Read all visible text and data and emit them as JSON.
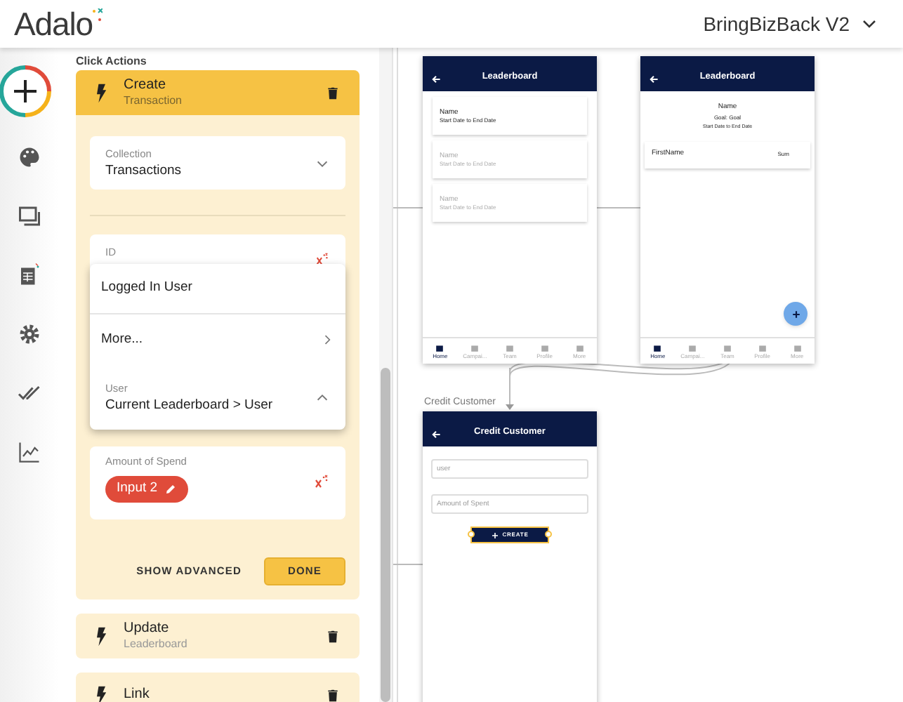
{
  "header": {
    "logo": "Adalo",
    "project_title": "BringBizBack V2"
  },
  "panel": {
    "heading": "Click Actions",
    "actions": [
      {
        "title": "Create",
        "subtitle": "Transaction",
        "expanded": true,
        "form": {
          "collection": {
            "label": "Collection",
            "value": "Transactions"
          },
          "id_field": {
            "label": "ID"
          },
          "menu": [
            {
              "kind": "option",
              "label": "Logged In User"
            },
            {
              "kind": "submenu",
              "label": "More..."
            },
            {
              "kind": "current",
              "label": "User",
              "value": "Current Leaderboard > User"
            }
          ],
          "amount": {
            "label": "Amount of Spend",
            "chip": "Input 2"
          },
          "advanced_button": "SHOW ADVANCED",
          "done_button": "DONE"
        }
      },
      {
        "title": "Update",
        "subtitle": "Leaderboard",
        "expanded": false
      },
      {
        "title": "Link",
        "expanded": false
      }
    ]
  },
  "canvas": {
    "screens": [
      {
        "kind": "list",
        "title": "Leaderboard",
        "items": [
          {
            "name": "Name",
            "dates": "Start Date to End Date",
            "faded": false
          },
          {
            "name": "Name",
            "dates": "Start Date to End Date",
            "faded": true
          },
          {
            "name": "Name",
            "dates": "Start Date to End Date",
            "faded": true
          }
        ],
        "tabs": [
          {
            "label": "Home",
            "selected": true
          },
          {
            "label": "Campai...",
            "selected": false
          },
          {
            "label": "Team",
            "selected": false
          },
          {
            "label": "Profile",
            "selected": false
          },
          {
            "label": "More",
            "selected": false
          }
        ]
      },
      {
        "kind": "detail",
        "title": "Leaderboard",
        "name": "Name",
        "goal": "Goal: Goal",
        "dates": "Start Date to End Date",
        "row": {
          "label": "FirstName",
          "value": "Sum"
        },
        "tabs": [
          {
            "label": "Home",
            "selected": true
          },
          {
            "label": "Campai...",
            "selected": false
          },
          {
            "label": "Team",
            "selected": false
          },
          {
            "label": "Profile",
            "selected": false
          },
          {
            "label": "More",
            "selected": false
          }
        ]
      },
      {
        "kind": "form",
        "label": "Credit Customer",
        "title": "Credit Customer",
        "inputs": [
          {
            "placeholder": "user"
          },
          {
            "placeholder": "Amount of Spent"
          }
        ],
        "button": "CREATE",
        "selected": true
      }
    ]
  }
}
